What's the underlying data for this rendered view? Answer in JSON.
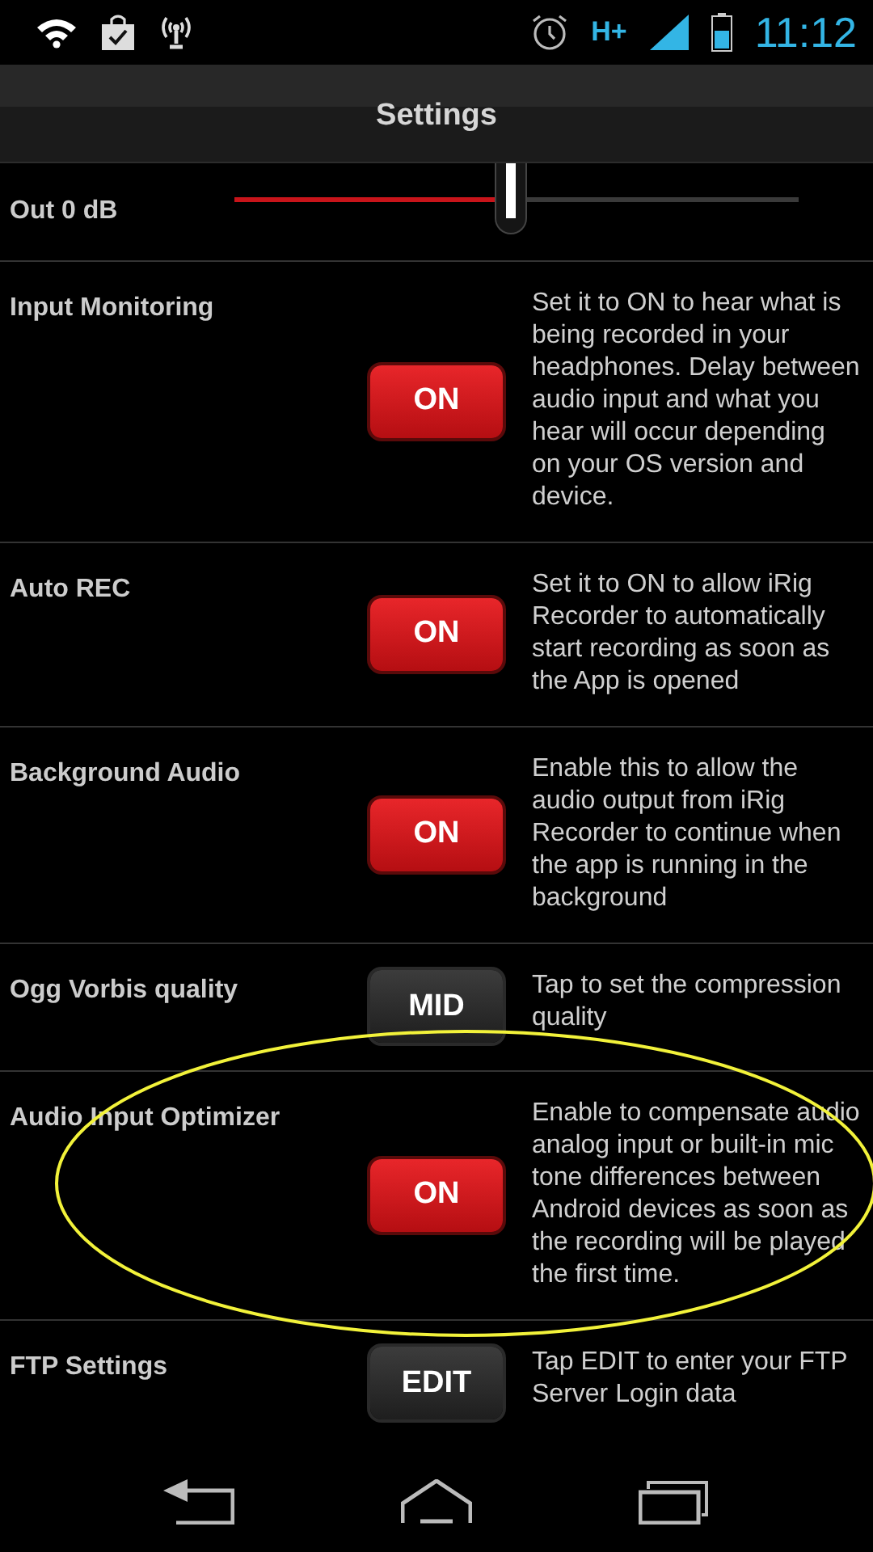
{
  "status_bar": {
    "network_type": "H+",
    "time": "11:12"
  },
  "title": "Settings",
  "slider": {
    "label": "Out 0 dB",
    "level": 0.49
  },
  "settings": [
    {
      "label": "Input Monitoring",
      "kind": "toggle",
      "button": "ON",
      "on": true,
      "description": "Set it to ON to hear what is being recorded in your headphones. Delay between audio input and what you hear will occur depending on your OS version and device."
    },
    {
      "label": "Auto REC",
      "kind": "toggle",
      "button": "ON",
      "on": true,
      "description": "Set it to ON to allow iRig Recorder to automatically start recording as soon as the App is opened"
    },
    {
      "label": "Background Audio",
      "kind": "toggle",
      "button": "ON",
      "on": true,
      "description": "Enable this to allow the audio output from iRig Recorder to continue when the app is running in the background"
    },
    {
      "label": "Ogg Vorbis quality",
      "kind": "action",
      "button": "MID",
      "description": "Tap to set the compression quality"
    },
    {
      "label": "Audio Input Optimizer",
      "kind": "toggle",
      "button": "ON",
      "on": true,
      "description": "Enable to compensate audio analog input or built-in mic tone differences between Android devices as soon as the recording will be played the first time."
    },
    {
      "label": "FTP Settings",
      "kind": "action",
      "button": "EDIT",
      "description": "Tap EDIT to enter your FTP Server Login data"
    }
  ],
  "annotation": {
    "kind": "ellipse"
  }
}
